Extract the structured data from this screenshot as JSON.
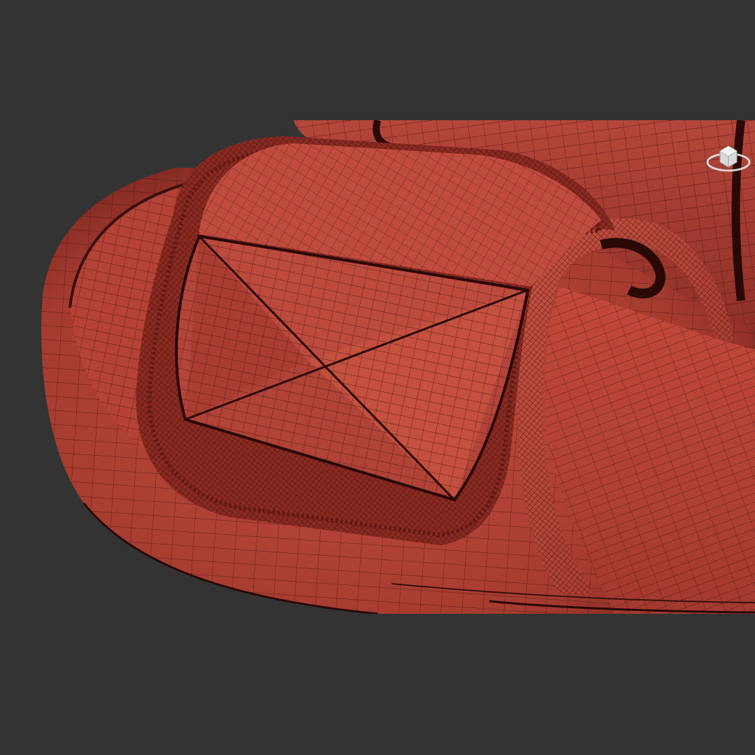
{
  "viewport": {
    "background_color": "#333333",
    "object": "sandal-slide-mesh",
    "display_mode": "wireframe-on-shaded",
    "mesh_color": "#b9463a",
    "wire_color": "#3a0f0c"
  },
  "navigation": {
    "viewcube_icon": "viewcube-icon"
  }
}
